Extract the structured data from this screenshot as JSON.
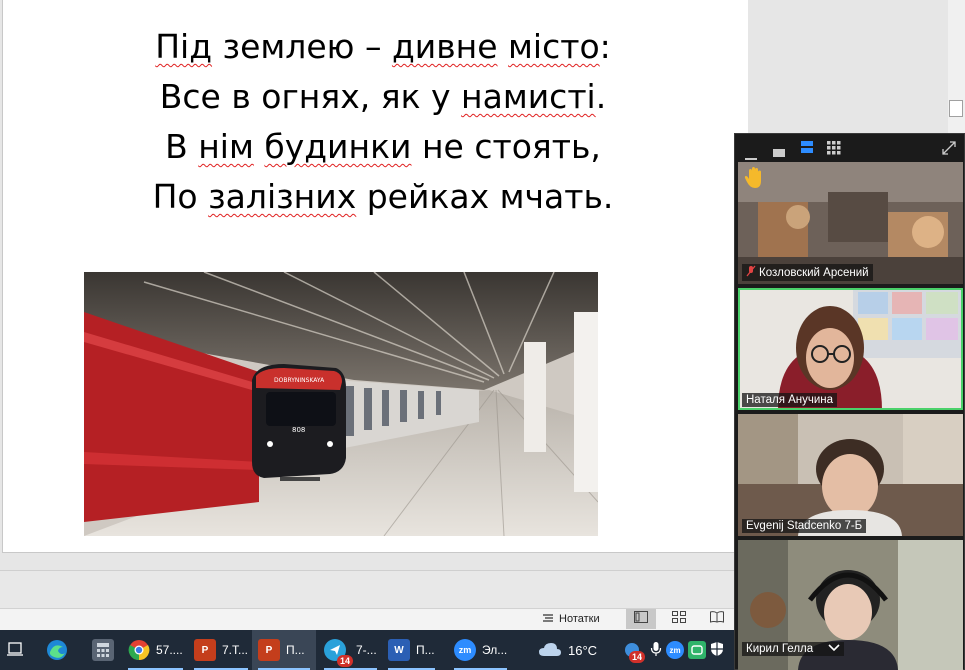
{
  "slide": {
    "lines": [
      {
        "parts": [
          {
            "t": "Під",
            "s": true
          },
          {
            "t": " ",
            "s": false
          },
          {
            "t": "землею",
            "s": false
          },
          {
            "t": " – ",
            "s": false
          },
          {
            "t": "дивне",
            "s": true
          },
          {
            "t": " ",
            "s": false
          },
          {
            "t": "місто",
            "s": true
          },
          {
            "t": ":",
            "s": false
          }
        ]
      },
      {
        "parts": [
          {
            "t": "Все в огнях, як у ",
            "s": false
          },
          {
            "t": "намисті",
            "s": true
          },
          {
            "t": ".",
            "s": false
          }
        ]
      },
      {
        "parts": [
          {
            "t": "В ",
            "s": false
          },
          {
            "t": "нім",
            "s": true
          },
          {
            "t": " ",
            "s": false
          },
          {
            "t": "будинки",
            "s": true
          },
          {
            "t": " не стоять,",
            "s": false
          }
        ]
      },
      {
        "parts": [
          {
            "t": "По ",
            "s": false
          },
          {
            "t": "залізних",
            "s": true
          },
          {
            "t": " рейках мчать.",
            "s": false
          }
        ]
      }
    ],
    "train_number": "808"
  },
  "statusbar": {
    "notes_label": "Нотатки"
  },
  "zoom": {
    "participants": [
      {
        "name": "Козловский Арсений",
        "muted": true,
        "raised_hand": true
      },
      {
        "name": "Наталя Анучина",
        "muted": false,
        "active_speaker": true
      },
      {
        "name": "Evgenij Stadcenko 7-Б",
        "muted": false
      },
      {
        "name": "Кирил Гелла",
        "muted": false
      }
    ]
  },
  "taskbar": {
    "items": [
      {
        "label": "57....",
        "icon": "chrome-icon"
      },
      {
        "label": "7.Т...",
        "icon": "powerpoint-icon"
      },
      {
        "label": "П...",
        "icon": "powerpoint-icon",
        "active": true
      },
      {
        "label": "7-...",
        "icon": "telegram-icon",
        "badge": "14"
      },
      {
        "label": "П...",
        "icon": "word-icon"
      },
      {
        "label": "Эл...",
        "icon": "zoom-icon"
      }
    ],
    "weather": "16°C",
    "tray_badge": "14",
    "zoom_logo": "zm"
  },
  "colors": {
    "taskbar_bg": "#1f2a38",
    "active_speaker": "#4bd16a",
    "spellcheck": "#e02020"
  }
}
